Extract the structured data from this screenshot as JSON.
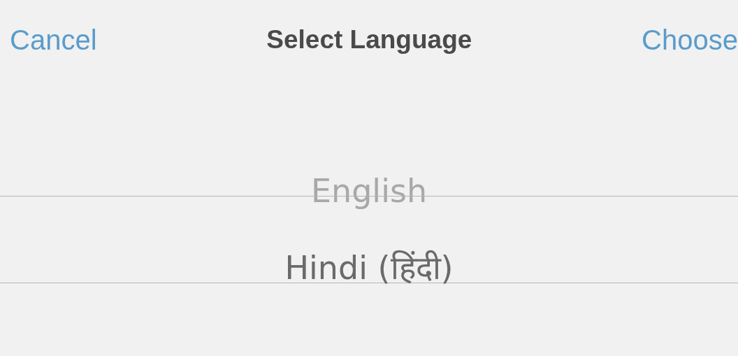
{
  "header": {
    "cancel": "Cancel",
    "title": "Select Language",
    "choose": "Choose"
  },
  "picker": {
    "rows": [
      {
        "label": "English",
        "selected": false
      },
      {
        "label": "Hindi (हिंदी)",
        "selected": true
      }
    ]
  }
}
